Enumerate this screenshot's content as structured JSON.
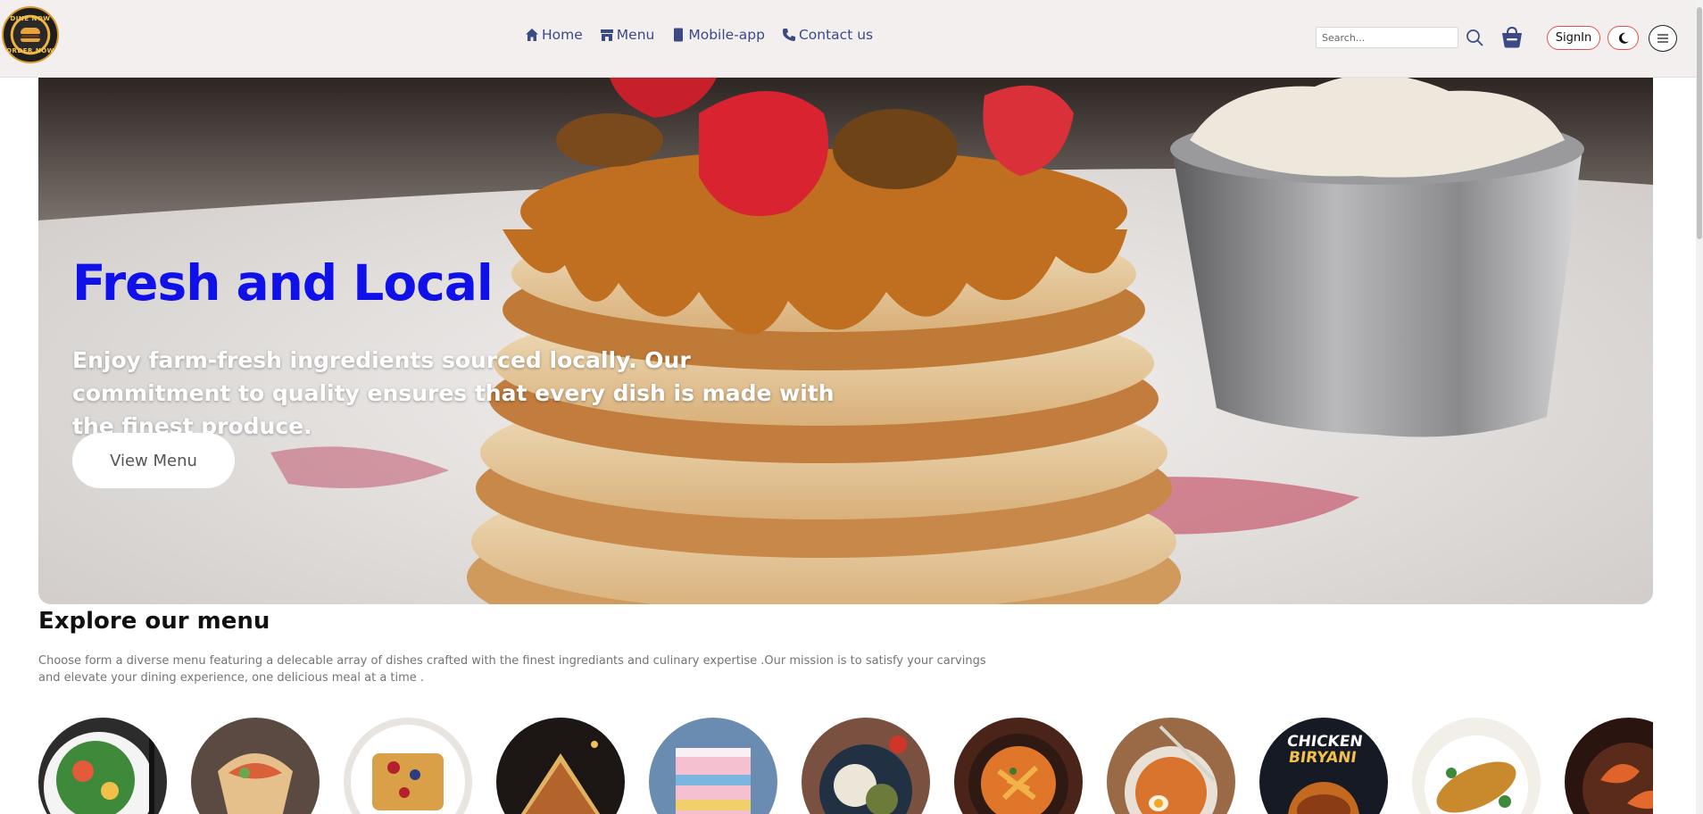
{
  "brand": {
    "logo_text_top": "DINE NOW",
    "logo_text_bottom": "ORDER NOW"
  },
  "nav": {
    "links": [
      {
        "label": "Home",
        "icon": "home-icon"
      },
      {
        "label": "Menu",
        "icon": "store-icon"
      },
      {
        "label": "Mobile-app",
        "icon": "mobile-icon"
      },
      {
        "label": "Contact us",
        "icon": "phone-icon"
      }
    ],
    "search_placeholder": "Search...",
    "signin_label": "SignIn"
  },
  "hero": {
    "title": "Fresh and Local",
    "text": "Enjoy farm-fresh ingredients sourced locally. Our commitment to quality ensures that every dish is made with the finest produce.",
    "button_label": "View Menu"
  },
  "explore": {
    "title": "Explore our menu",
    "description": "Choose form a diverse menu featuring a delecable array of dishes crafted with the finest ingrediants and culinary expertise .Our mission is to satisfy your carvings and elevate your dining experience, one delicious meal at a time .",
    "category_image_texts": [
      "CHICKEN",
      "BIRYANI"
    ]
  },
  "colors": {
    "accent_blue": "#1010e8",
    "nav_text": "#3b4a85",
    "signin_border": "#e05050",
    "header_bg": "#f3efef"
  }
}
